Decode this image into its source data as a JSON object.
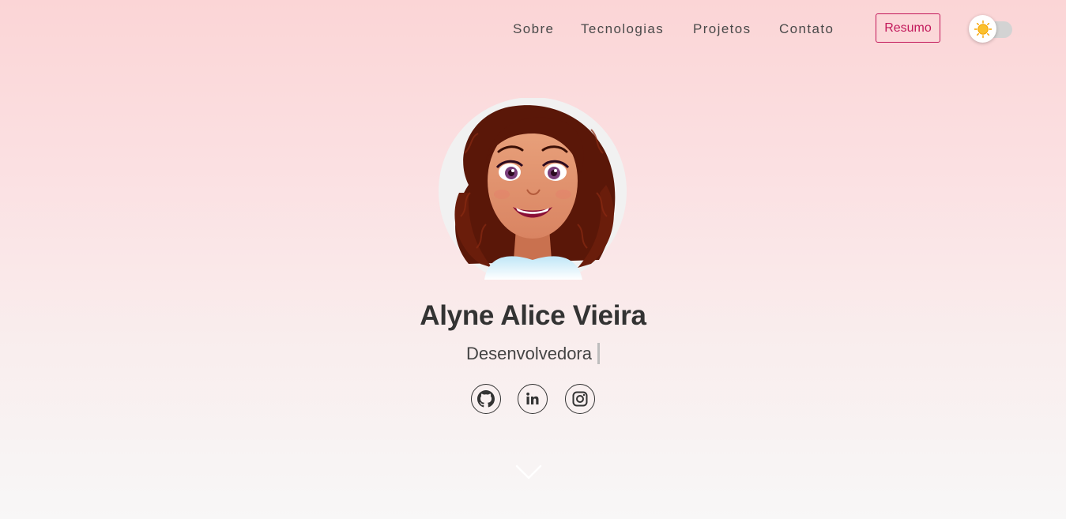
{
  "nav": {
    "links": [
      {
        "label": "Sobre"
      },
      {
        "label": "Tecnologias"
      },
      {
        "label": "Projetos"
      },
      {
        "label": "Contato"
      }
    ],
    "resume_label": "Resumo",
    "theme_toggle": {
      "state": "light",
      "icon": "sun-icon"
    }
  },
  "hero": {
    "avatar_icon": "cartoon-avatar",
    "name": "Alyne Alice Vieira",
    "role": "Desenvolvedora",
    "social": [
      {
        "icon": "github-icon"
      },
      {
        "icon": "linkedin-icon"
      },
      {
        "icon": "instagram-icon"
      }
    ],
    "scroll_icon": "chevron-down-icon"
  },
  "colors": {
    "accent": "#c2185b",
    "text": "#333333",
    "bg_top": "#fbd5d6",
    "bg_bottom": "#f8f7f7"
  }
}
